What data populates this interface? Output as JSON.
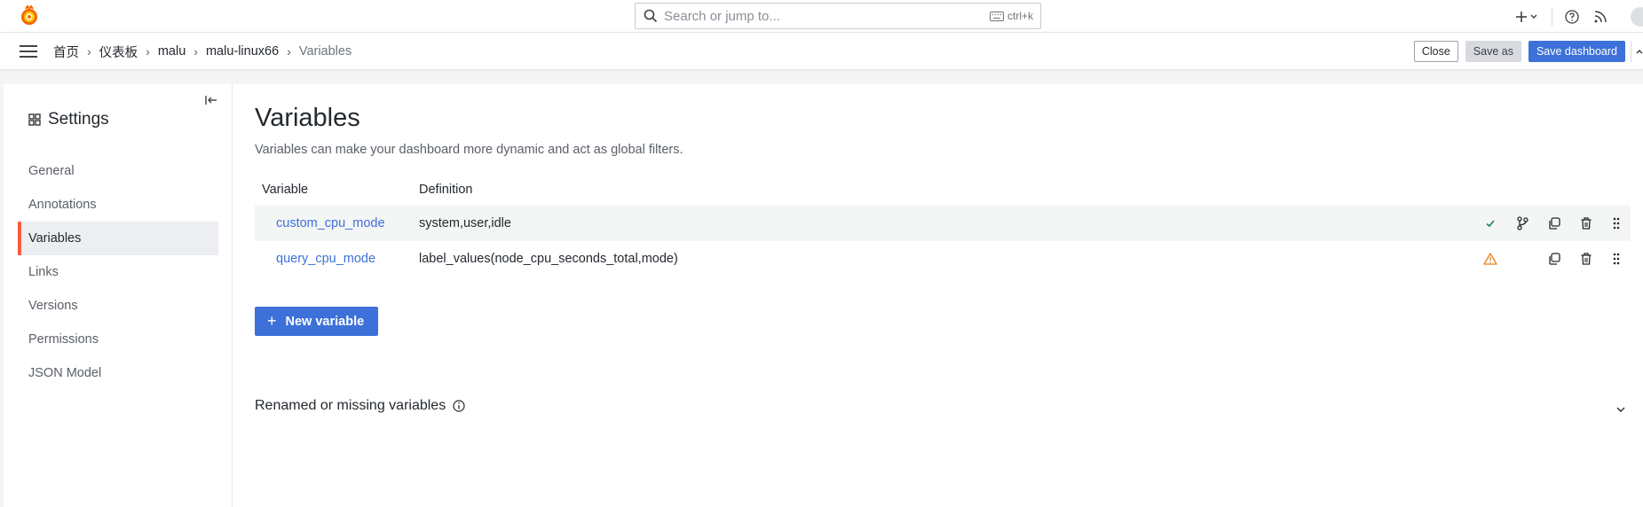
{
  "search": {
    "placeholder": "Search or jump to...",
    "shortcut": "ctrl+k"
  },
  "breadcrumbs": [
    "首页",
    "仪表板",
    "malu",
    "malu-linux66",
    "Variables"
  ],
  "toolbar": {
    "close_label": "Close",
    "save_as_label": "Save as",
    "save_label": "Save dashboard"
  },
  "sidebar": {
    "title": "Settings",
    "items": [
      {
        "label": "General",
        "active": false
      },
      {
        "label": "Annotations",
        "active": false
      },
      {
        "label": "Variables",
        "active": true
      },
      {
        "label": "Links",
        "active": false
      },
      {
        "label": "Versions",
        "active": false
      },
      {
        "label": "Permissions",
        "active": false
      },
      {
        "label": "JSON Model",
        "active": false
      }
    ]
  },
  "main": {
    "title": "Variables",
    "description": "Variables can make your dashboard more dynamic and act as global filters.",
    "columns": [
      "Variable",
      "Definition"
    ],
    "rows": [
      {
        "name": "custom_cpu_mode",
        "definition": "system,user,idle",
        "status": "ok"
      },
      {
        "name": "query_cpu_mode",
        "definition": "label_values(node_cpu_seconds_total,mode)",
        "status": "warning"
      }
    ],
    "new_variable_label": "New variable",
    "renamed_label": "Renamed or missing variables"
  },
  "colors": {
    "accent": "#3d71d9",
    "active_marker": "#f55f3e",
    "ok": "#1a7f4b",
    "warning": "#e5811a"
  }
}
